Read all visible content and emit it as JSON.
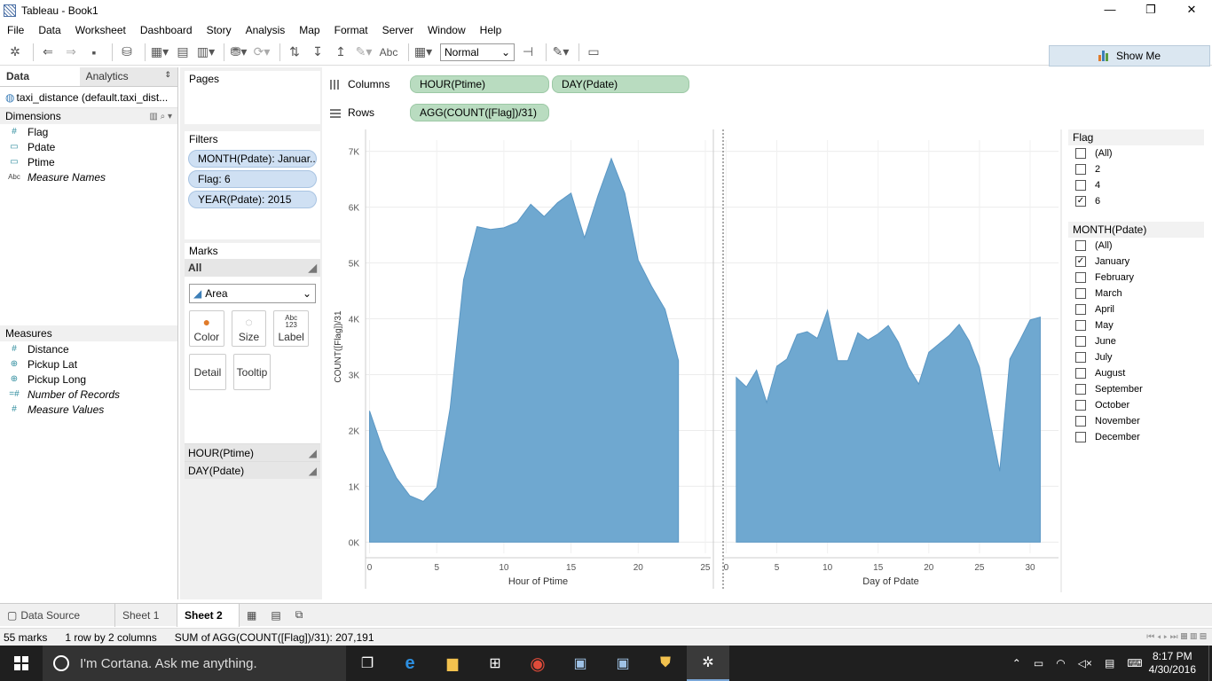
{
  "window": {
    "title": "Tableau - Book1"
  },
  "menu": [
    "File",
    "Data",
    "Worksheet",
    "Dashboard",
    "Story",
    "Analysis",
    "Map",
    "Format",
    "Server",
    "Window",
    "Help"
  ],
  "toolbar": {
    "fit_value": "Normal",
    "abc_label": "Abc",
    "show_me": "Show Me"
  },
  "data_pane": {
    "tabs": {
      "data": "Data",
      "analytics": "Analytics"
    },
    "datasource": "taxi_distance (default.taxi_dist...",
    "dimensions_header": "Dimensions",
    "dimensions": [
      {
        "icon": "#",
        "name": "Flag"
      },
      {
        "icon": "▭",
        "name": "Pdate"
      },
      {
        "icon": "▭",
        "name": "Ptime"
      },
      {
        "icon": "Abc",
        "name": "Measure Names"
      }
    ],
    "measures_header": "Measures",
    "measures": [
      {
        "icon": "#",
        "name": "Distance"
      },
      {
        "icon": "⊕",
        "name": "Pickup Lat"
      },
      {
        "icon": "⊕",
        "name": "Pickup Long"
      },
      {
        "icon": "=#",
        "name": "Number of Records"
      },
      {
        "icon": "#",
        "name": "Measure Values"
      }
    ]
  },
  "cards": {
    "pages": "Pages",
    "filters_header": "Filters",
    "filters": [
      "MONTH(Pdate): Januar..",
      "Flag: 6",
      "YEAR(Pdate): 2015"
    ],
    "marks_header": "Marks",
    "marks_all": "All",
    "mark_type": "Area",
    "mark_buttons": {
      "color": "Color",
      "size": "Size",
      "label": "Label",
      "detail": "Detail",
      "tooltip": "Tooltip",
      "label_icon": "Abc\n123"
    },
    "mark_sub": [
      "HOUR(Ptime)",
      "DAY(Pdate)"
    ]
  },
  "shelves": {
    "columns_label": "Columns",
    "columns": [
      "HOUR(Ptime)",
      "DAY(Pdate)"
    ],
    "rows_label": "Rows",
    "rows": [
      "AGG(COUNT([Flag])/31)"
    ]
  },
  "chart_data": {
    "type": "area",
    "ylabel": "COUNT([Flag])/31",
    "ylim": [
      -200,
      7200
    ],
    "yticks": [
      0,
      1000,
      2000,
      3000,
      4000,
      5000,
      6000,
      7000
    ],
    "ytick_labels": [
      "0K",
      "1K",
      "2K",
      "3K",
      "4K",
      "5K",
      "6K",
      "7K"
    ],
    "color": "#6fa8d0",
    "panes": [
      {
        "xlabel": "Hour of Ptime",
        "xlim": [
          -0.3,
          25.4
        ],
        "xticks": [
          0,
          5,
          10,
          15,
          20,
          25
        ],
        "x": [
          0,
          1,
          2,
          3,
          4,
          5,
          6,
          7,
          8,
          9,
          10,
          11,
          12,
          13,
          14,
          15,
          16,
          17,
          18,
          19,
          20,
          21,
          22,
          23
        ],
        "values": [
          2350,
          1650,
          1150,
          830,
          730,
          980,
          2400,
          4700,
          5650,
          5600,
          5630,
          5730,
          6050,
          5830,
          6080,
          6250,
          5450,
          6200,
          6870,
          6250,
          5050,
          4580,
          4170,
          3250
        ]
      },
      {
        "xlabel": "Day of Pdate",
        "xlim": [
          -0.3,
          32.8
        ],
        "xticks": [
          0,
          5,
          10,
          15,
          20,
          25,
          30
        ],
        "x": [
          1,
          2,
          3,
          4,
          5,
          6,
          7,
          8,
          9,
          10,
          11,
          12,
          13,
          14,
          15,
          16,
          17,
          18,
          19,
          20,
          21,
          22,
          23,
          24,
          25,
          26,
          27,
          28,
          29,
          30,
          31
        ],
        "values": [
          2950,
          2780,
          3080,
          2500,
          3150,
          3280,
          3720,
          3770,
          3650,
          4150,
          3250,
          3250,
          3750,
          3620,
          3730,
          3880,
          3580,
          3130,
          2830,
          3400,
          3550,
          3700,
          3900,
          3600,
          3130,
          2200,
          1270,
          3280,
          3620,
          3980,
          4030
        ]
      }
    ]
  },
  "legends": {
    "flag": {
      "title": "Flag",
      "items": [
        {
          "label": "(All)",
          "checked": false
        },
        {
          "label": "2",
          "checked": false
        },
        {
          "label": "4",
          "checked": false
        },
        {
          "label": "6",
          "checked": true
        }
      ]
    },
    "month": {
      "title": "MONTH(Pdate)",
      "items": [
        {
          "label": "(All)",
          "checked": false
        },
        {
          "label": "January",
          "checked": true
        },
        {
          "label": "February",
          "checked": false
        },
        {
          "label": "March",
          "checked": false
        },
        {
          "label": "April",
          "checked": false
        },
        {
          "label": "May",
          "checked": false
        },
        {
          "label": "June",
          "checked": false
        },
        {
          "label": "July",
          "checked": false
        },
        {
          "label": "August",
          "checked": false
        },
        {
          "label": "September",
          "checked": false
        },
        {
          "label": "October",
          "checked": false
        },
        {
          "label": "November",
          "checked": false
        },
        {
          "label": "December",
          "checked": false
        }
      ]
    }
  },
  "sheet_tabs": {
    "datasource": "Data Source",
    "sheet1": "Sheet 1",
    "sheet2": "Sheet 2"
  },
  "status": {
    "marks": "55 marks",
    "layout": "1 row by 2 columns",
    "sum": "SUM of AGG(COUNT([Flag])/31): 207,191"
  },
  "taskbar": {
    "cortana": "I'm Cortana. Ask me anything.",
    "time": "8:17 PM",
    "date": "4/30/2016"
  }
}
